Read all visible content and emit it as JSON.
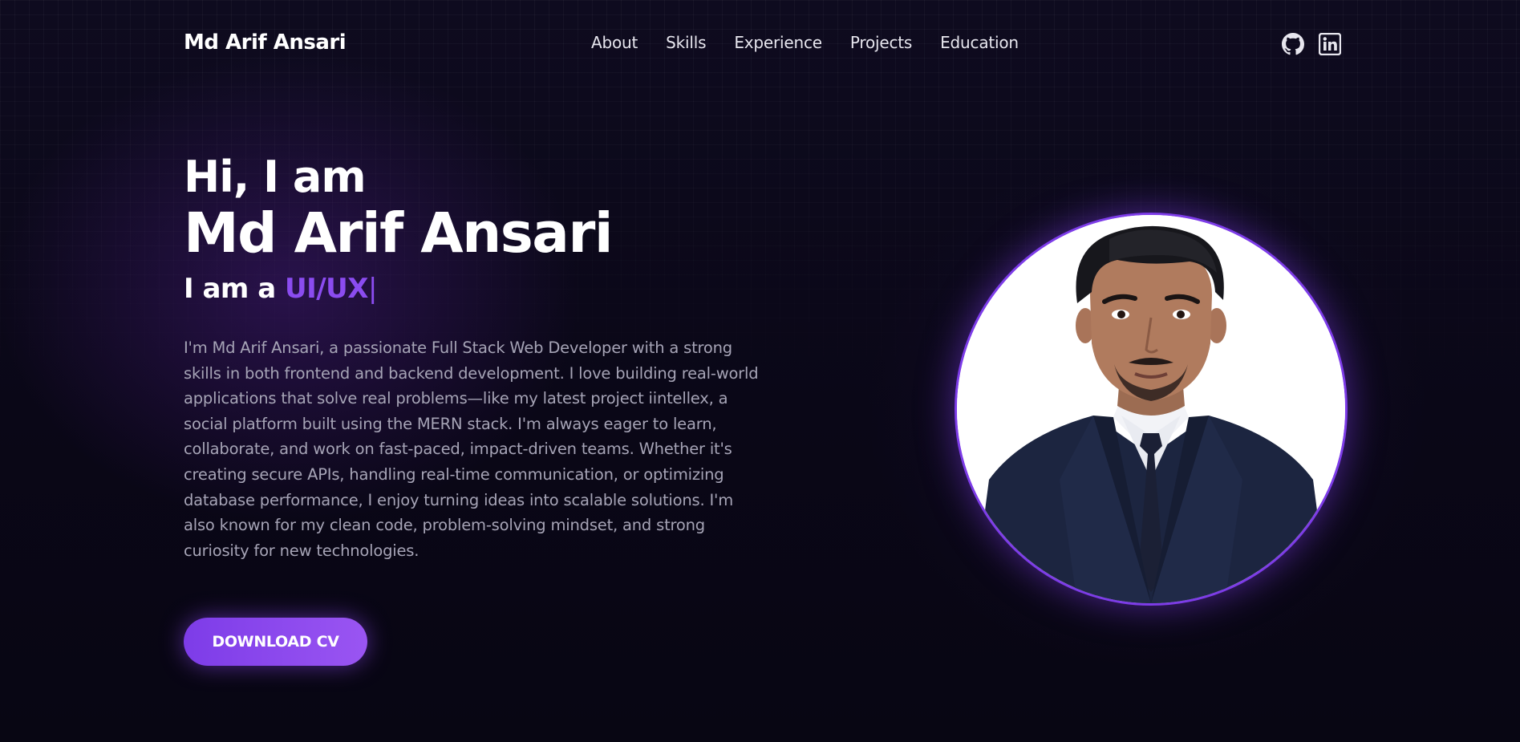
{
  "header": {
    "brand": "Md Arif Ansari",
    "nav": [
      {
        "label": "About"
      },
      {
        "label": "Skills"
      },
      {
        "label": "Experience"
      },
      {
        "label": "Projects"
      },
      {
        "label": "Education"
      }
    ],
    "social": [
      {
        "icon": "github-icon"
      },
      {
        "icon": "linkedin-icon"
      }
    ]
  },
  "hero": {
    "greeting": "Hi, I am",
    "name": "Md Arif Ansari",
    "role_prefix": "I am a ",
    "role_typed": "UI/UX",
    "cursor": "|",
    "bio": "I'm Md Arif Ansari, a passionate Full Stack Web Developer with a strong skills in both frontend and backend development. I love building real-world applications that solve real problems—like my latest project iintellex, a social platform built using the MERN stack. I'm always eager to learn, collaborate, and work on fast-paced, impact-driven teams. Whether it's creating secure APIs, handling real-time communication, or optimizing database performance, I enjoy turning ideas into scalable solutions. I'm also known for my clean code, problem-solving mindset, and strong curiosity for new technologies.",
    "cta_label": "DOWNLOAD CV"
  },
  "colors": {
    "accent": "#8b4cf0",
    "background": "#0b0818",
    "text_primary": "#ffffff",
    "text_muted": "#a6a4b6"
  }
}
